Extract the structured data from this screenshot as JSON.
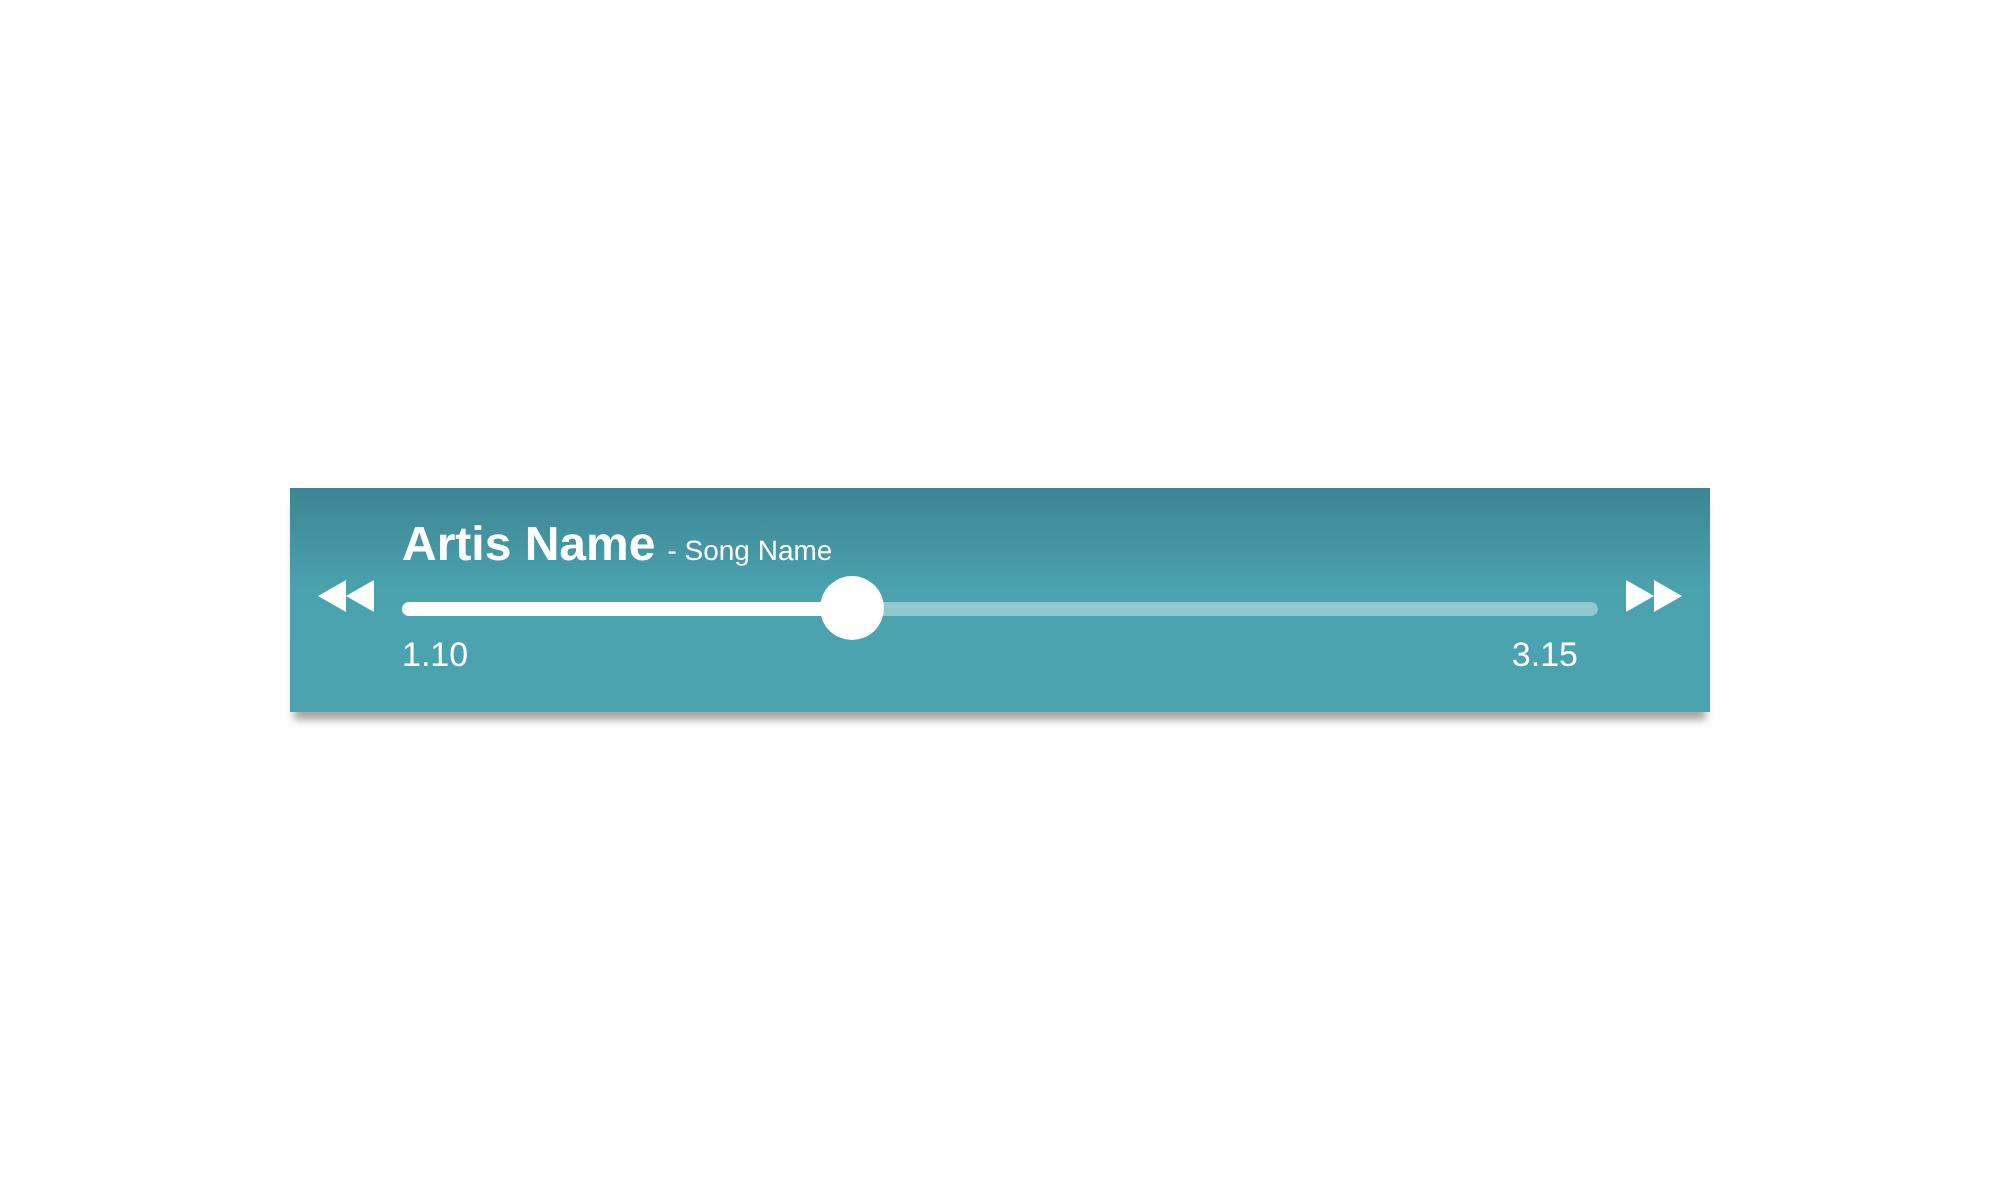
{
  "player": {
    "artist": "Artis Name",
    "song": "- Song Name",
    "level": 0.377,
    "elapsed": "1.10",
    "total": "3.15"
  }
}
